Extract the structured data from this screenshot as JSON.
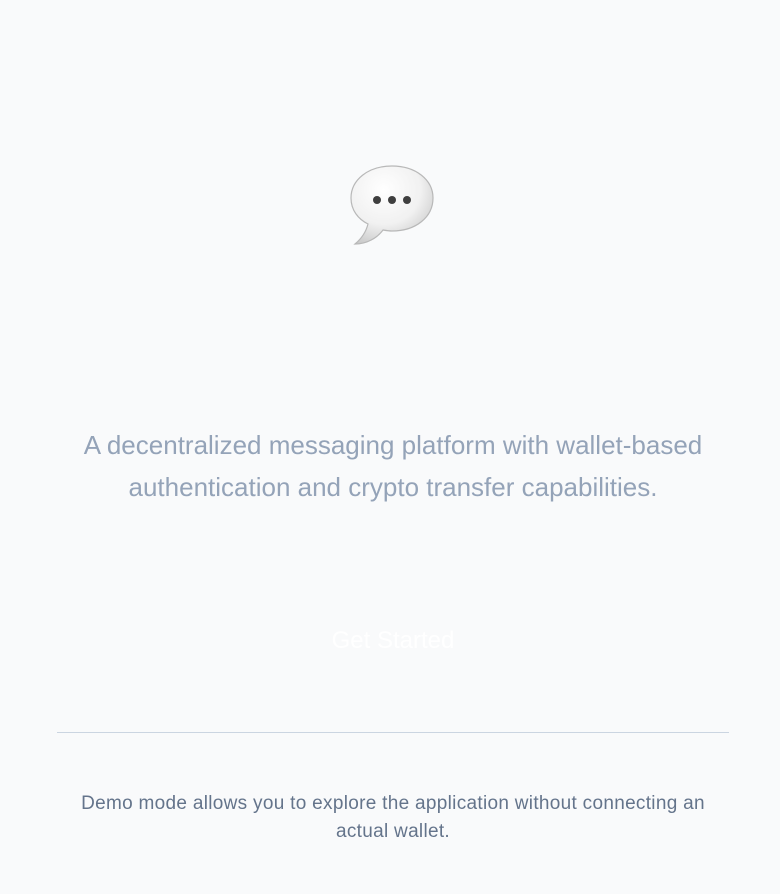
{
  "hero": {
    "icon": "speech-bubble-icon",
    "tagline": "A decentralized messaging platform with wallet-based authentication and crypto transfer capabilities."
  },
  "actions": {
    "get_started_label": "Get Started"
  },
  "footer": {
    "demo_note": "Demo mode allows you to explore the application without connecting an actual wallet."
  },
  "colors": {
    "background": "#f9fafb",
    "tagline": "#94a3b8",
    "note": "#64748b",
    "divider": "#cbd5e1"
  }
}
